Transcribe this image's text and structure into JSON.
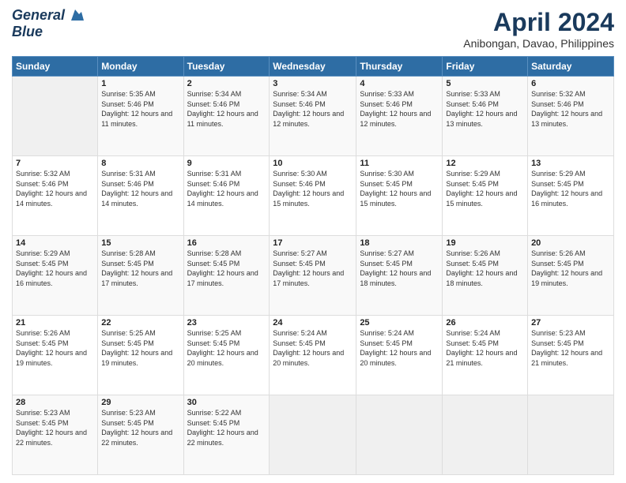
{
  "logo": {
    "line1": "General",
    "line2": "Blue"
  },
  "title": "April 2024",
  "location": "Anibongan, Davao, Philippines",
  "days_of_week": [
    "Sunday",
    "Monday",
    "Tuesday",
    "Wednesday",
    "Thursday",
    "Friday",
    "Saturday"
  ],
  "weeks": [
    [
      {
        "day": "",
        "sunrise": "",
        "sunset": "",
        "daylight": ""
      },
      {
        "day": "1",
        "sunrise": "Sunrise: 5:35 AM",
        "sunset": "Sunset: 5:46 PM",
        "daylight": "Daylight: 12 hours and 11 minutes."
      },
      {
        "day": "2",
        "sunrise": "Sunrise: 5:34 AM",
        "sunset": "Sunset: 5:46 PM",
        "daylight": "Daylight: 12 hours and 11 minutes."
      },
      {
        "day": "3",
        "sunrise": "Sunrise: 5:34 AM",
        "sunset": "Sunset: 5:46 PM",
        "daylight": "Daylight: 12 hours and 12 minutes."
      },
      {
        "day": "4",
        "sunrise": "Sunrise: 5:33 AM",
        "sunset": "Sunset: 5:46 PM",
        "daylight": "Daylight: 12 hours and 12 minutes."
      },
      {
        "day": "5",
        "sunrise": "Sunrise: 5:33 AM",
        "sunset": "Sunset: 5:46 PM",
        "daylight": "Daylight: 12 hours and 13 minutes."
      },
      {
        "day": "6",
        "sunrise": "Sunrise: 5:32 AM",
        "sunset": "Sunset: 5:46 PM",
        "daylight": "Daylight: 12 hours and 13 minutes."
      }
    ],
    [
      {
        "day": "7",
        "sunrise": "Sunrise: 5:32 AM",
        "sunset": "Sunset: 5:46 PM",
        "daylight": "Daylight: 12 hours and 14 minutes."
      },
      {
        "day": "8",
        "sunrise": "Sunrise: 5:31 AM",
        "sunset": "Sunset: 5:46 PM",
        "daylight": "Daylight: 12 hours and 14 minutes."
      },
      {
        "day": "9",
        "sunrise": "Sunrise: 5:31 AM",
        "sunset": "Sunset: 5:46 PM",
        "daylight": "Daylight: 12 hours and 14 minutes."
      },
      {
        "day": "10",
        "sunrise": "Sunrise: 5:30 AM",
        "sunset": "Sunset: 5:46 PM",
        "daylight": "Daylight: 12 hours and 15 minutes."
      },
      {
        "day": "11",
        "sunrise": "Sunrise: 5:30 AM",
        "sunset": "Sunset: 5:45 PM",
        "daylight": "Daylight: 12 hours and 15 minutes."
      },
      {
        "day": "12",
        "sunrise": "Sunrise: 5:29 AM",
        "sunset": "Sunset: 5:45 PM",
        "daylight": "Daylight: 12 hours and 15 minutes."
      },
      {
        "day": "13",
        "sunrise": "Sunrise: 5:29 AM",
        "sunset": "Sunset: 5:45 PM",
        "daylight": "Daylight: 12 hours and 16 minutes."
      }
    ],
    [
      {
        "day": "14",
        "sunrise": "Sunrise: 5:29 AM",
        "sunset": "Sunset: 5:45 PM",
        "daylight": "Daylight: 12 hours and 16 minutes."
      },
      {
        "day": "15",
        "sunrise": "Sunrise: 5:28 AM",
        "sunset": "Sunset: 5:45 PM",
        "daylight": "Daylight: 12 hours and 17 minutes."
      },
      {
        "day": "16",
        "sunrise": "Sunrise: 5:28 AM",
        "sunset": "Sunset: 5:45 PM",
        "daylight": "Daylight: 12 hours and 17 minutes."
      },
      {
        "day": "17",
        "sunrise": "Sunrise: 5:27 AM",
        "sunset": "Sunset: 5:45 PM",
        "daylight": "Daylight: 12 hours and 17 minutes."
      },
      {
        "day": "18",
        "sunrise": "Sunrise: 5:27 AM",
        "sunset": "Sunset: 5:45 PM",
        "daylight": "Daylight: 12 hours and 18 minutes."
      },
      {
        "day": "19",
        "sunrise": "Sunrise: 5:26 AM",
        "sunset": "Sunset: 5:45 PM",
        "daylight": "Daylight: 12 hours and 18 minutes."
      },
      {
        "day": "20",
        "sunrise": "Sunrise: 5:26 AM",
        "sunset": "Sunset: 5:45 PM",
        "daylight": "Daylight: 12 hours and 19 minutes."
      }
    ],
    [
      {
        "day": "21",
        "sunrise": "Sunrise: 5:26 AM",
        "sunset": "Sunset: 5:45 PM",
        "daylight": "Daylight: 12 hours and 19 minutes."
      },
      {
        "day": "22",
        "sunrise": "Sunrise: 5:25 AM",
        "sunset": "Sunset: 5:45 PM",
        "daylight": "Daylight: 12 hours and 19 minutes."
      },
      {
        "day": "23",
        "sunrise": "Sunrise: 5:25 AM",
        "sunset": "Sunset: 5:45 PM",
        "daylight": "Daylight: 12 hours and 20 minutes."
      },
      {
        "day": "24",
        "sunrise": "Sunrise: 5:24 AM",
        "sunset": "Sunset: 5:45 PM",
        "daylight": "Daylight: 12 hours and 20 minutes."
      },
      {
        "day": "25",
        "sunrise": "Sunrise: 5:24 AM",
        "sunset": "Sunset: 5:45 PM",
        "daylight": "Daylight: 12 hours and 20 minutes."
      },
      {
        "day": "26",
        "sunrise": "Sunrise: 5:24 AM",
        "sunset": "Sunset: 5:45 PM",
        "daylight": "Daylight: 12 hours and 21 minutes."
      },
      {
        "day": "27",
        "sunrise": "Sunrise: 5:23 AM",
        "sunset": "Sunset: 5:45 PM",
        "daylight": "Daylight: 12 hours and 21 minutes."
      }
    ],
    [
      {
        "day": "28",
        "sunrise": "Sunrise: 5:23 AM",
        "sunset": "Sunset: 5:45 PM",
        "daylight": "Daylight: 12 hours and 22 minutes."
      },
      {
        "day": "29",
        "sunrise": "Sunrise: 5:23 AM",
        "sunset": "Sunset: 5:45 PM",
        "daylight": "Daylight: 12 hours and 22 minutes."
      },
      {
        "day": "30",
        "sunrise": "Sunrise: 5:22 AM",
        "sunset": "Sunset: 5:45 PM",
        "daylight": "Daylight: 12 hours and 22 minutes."
      },
      {
        "day": "",
        "sunrise": "",
        "sunset": "",
        "daylight": ""
      },
      {
        "day": "",
        "sunrise": "",
        "sunset": "",
        "daylight": ""
      },
      {
        "day": "",
        "sunrise": "",
        "sunset": "",
        "daylight": ""
      },
      {
        "day": "",
        "sunrise": "",
        "sunset": "",
        "daylight": ""
      }
    ]
  ]
}
